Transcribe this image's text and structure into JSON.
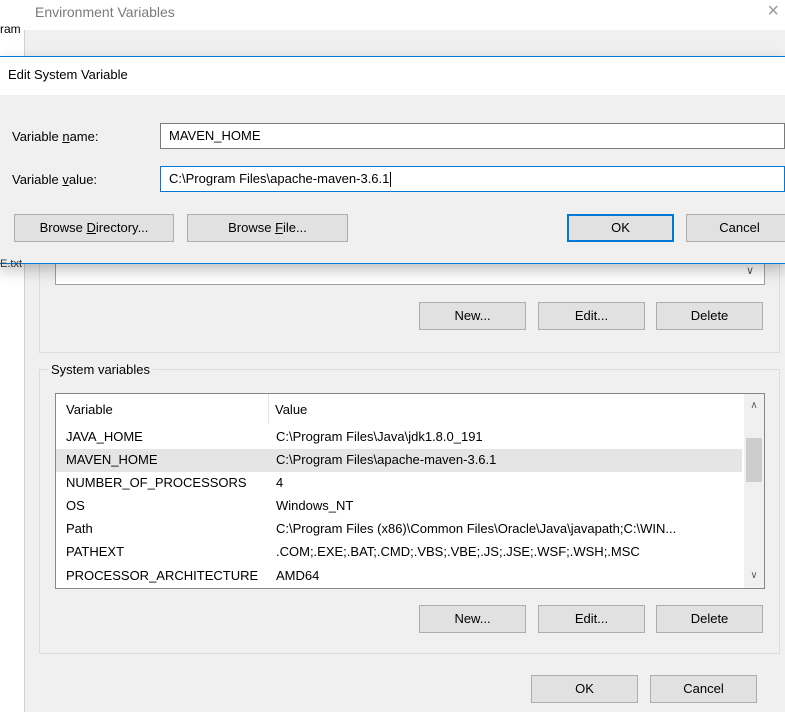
{
  "background": {
    "left_text_1": "ram",
    "left_text_2": "E.txt"
  },
  "env_window": {
    "title": "Environment Variables",
    "close_icon": "×",
    "user_buttons": {
      "new": "New...",
      "edit": "Edit...",
      "delete": "Delete"
    },
    "system_group_label": "System variables",
    "system_table": {
      "headers": [
        "Variable",
        "Value"
      ],
      "rows": [
        {
          "name": "JAVA_HOME",
          "value": "C:\\Program Files\\Java\\jdk1.8.0_191"
        },
        {
          "name": "MAVEN_HOME",
          "value": "C:\\Program Files\\apache-maven-3.6.1"
        },
        {
          "name": "NUMBER_OF_PROCESSORS",
          "value": "4"
        },
        {
          "name": "OS",
          "value": "Windows_NT"
        },
        {
          "name": "Path",
          "value": "C:\\Program Files (x86)\\Common Files\\Oracle\\Java\\javapath;C:\\WIN..."
        },
        {
          "name": "PATHEXT",
          "value": ".COM;.EXE;.BAT;.CMD;.VBS;.VBE;.JS;.JSE;.WSF;.WSH;.MSC"
        },
        {
          "name": "PROCESSOR_ARCHITECTURE",
          "value": "AMD64"
        }
      ],
      "selected_index": 1
    },
    "system_buttons": {
      "new": "New...",
      "edit": "Edit...",
      "delete": "Delete"
    },
    "ok": "OK",
    "cancel": "Cancel"
  },
  "edit_dialog": {
    "title": "Edit System Variable",
    "name_label_pre": "Variable ",
    "name_label_u": "n",
    "name_label_post": "ame:",
    "value_label_pre": "Variable ",
    "value_label_u": "v",
    "value_label_post": "alue:",
    "name_value": "MAVEN_HOME",
    "value_value": "C:\\Program Files\\apache-maven-3.6.1",
    "browse_dir_pre": "Browse ",
    "browse_dir_u": "D",
    "browse_dir_post": "irectory...",
    "browse_file_pre": "Browse ",
    "browse_file_u": "F",
    "browse_file_post": "ile...",
    "ok": "OK",
    "cancel": "Cancel"
  },
  "colors": {
    "accent": "#0078d7",
    "dialog_bg": "#f0f0f0",
    "selected_row": "#e5e5e5"
  }
}
